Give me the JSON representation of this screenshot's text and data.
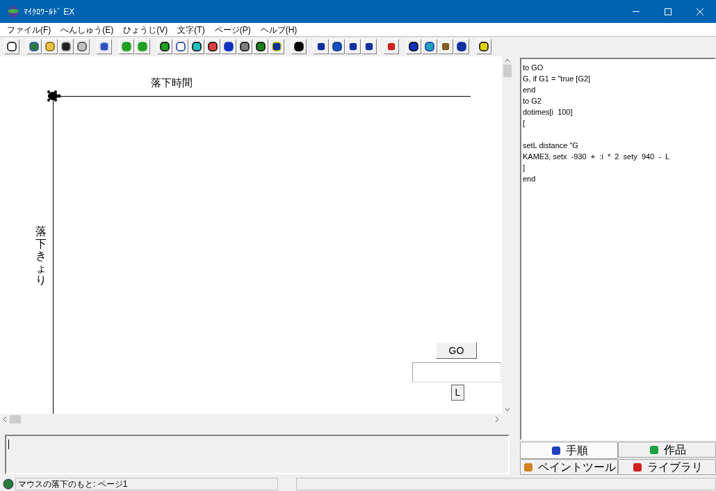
{
  "window": {
    "title": "ﾏｲｸﾛﾜｰﾙﾄﾞ EX"
  },
  "menu": [
    "ファイル(F)",
    "へんしゅう(E)",
    "ひょうじ(V)",
    "文字(T)",
    "ページ(P)",
    "ヘルプ(H)"
  ],
  "canvas": {
    "x_label": "落下時間",
    "y_label": "落下きょり",
    "go_button": "GO",
    "l_button": "L"
  },
  "code_blocks": [
    [
      "to GO",
      "G, if G1 = \"true [G2]",
      "end",
      "to G2",
      "dotimes[i  100]",
      "["
    ],
    [
      "setL distance \"G",
      "KAME3, setx  -930  +  :i  *  2  sety  940  -  L",
      "]",
      "end"
    ]
  ],
  "tabs": [
    {
      "label": "手順",
      "selected": true
    },
    {
      "label": "作品",
      "selected": false
    },
    {
      "label": "ペイントツール",
      "selected": false
    },
    {
      "label": "ライブラリ",
      "selected": false
    }
  ],
  "status_bar": {
    "text": "マウスの落下のもと: ページ1"
  }
}
